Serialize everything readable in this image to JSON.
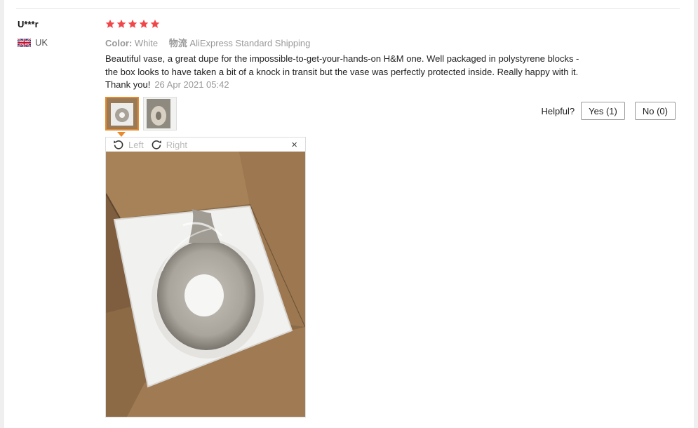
{
  "review": {
    "user": "U***r",
    "country": "UK",
    "rating": 5,
    "color_label": "Color:",
    "color_value": "White",
    "shipping_label": "物流",
    "shipping_value": "AliExpress Standard Shipping",
    "text_line1": "Beautiful vase, a great dupe for the impossible-to-get-your-hands-on H&M one. Well packaged in polystyrene blocks -",
    "text_line2": "the box looks to have taken a bit of a knock in transit but the vase was perfectly protected inside. Really happy with it.",
    "text_line3": "Thank you!",
    "date": "26 Apr 2021 05:42"
  },
  "helpful": {
    "label": "Helpful?",
    "yes_label": "Yes (1)",
    "no_label": "No (0)"
  },
  "viewer": {
    "rotate_left_label": "Left",
    "rotate_right_label": "Right",
    "close_symbol": "×"
  },
  "colors": {
    "star": "#f0474a",
    "accent": "#e68a2e"
  }
}
